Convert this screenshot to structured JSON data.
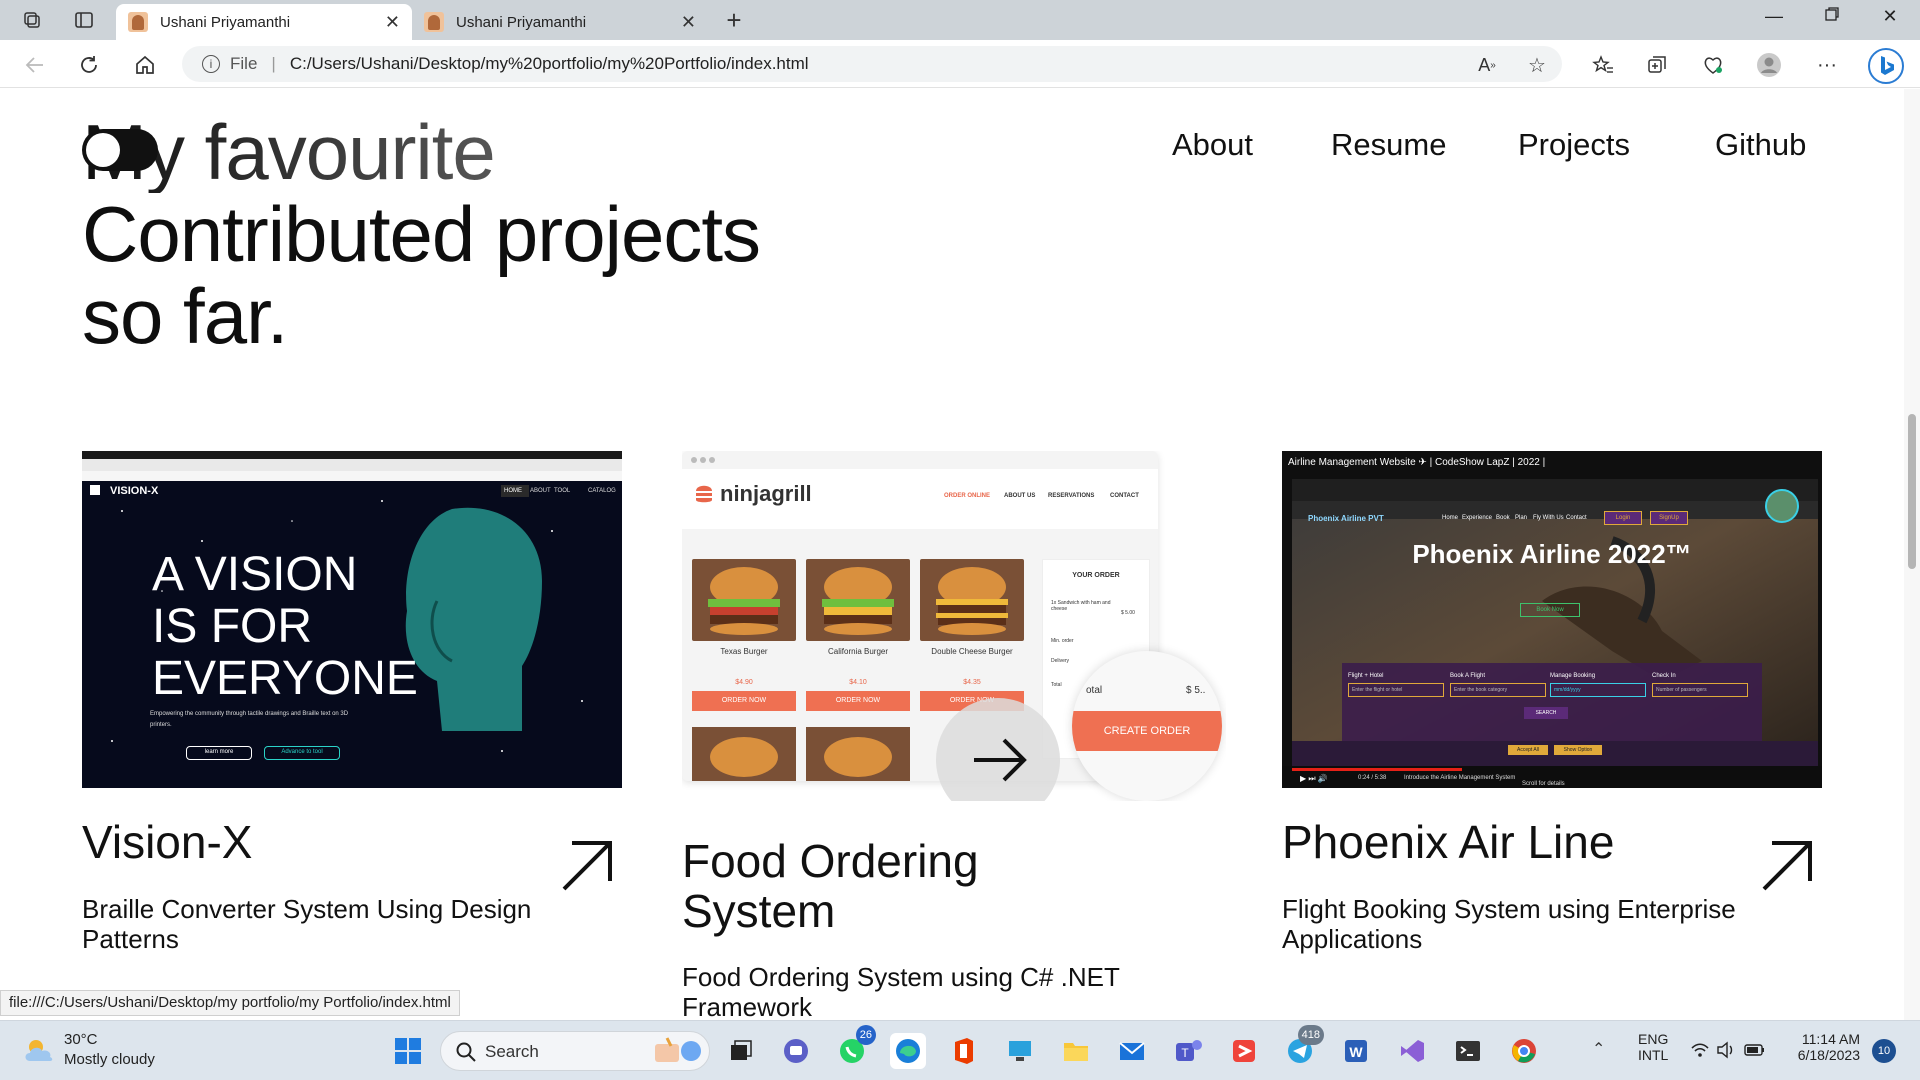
{
  "browser": {
    "tabs": [
      {
        "title": "Ushani Priyamanthi",
        "active": true
      },
      {
        "title": "Ushani Priyamanthi",
        "active": false
      }
    ],
    "address_prefix": "File",
    "address": "C:/Users/Ushani/Desktop/my%20portfolio/my%20Portfolio/index.html",
    "status_url": "file:///C:/Users/Ushani/Desktop/my portfolio/my Portfolio/index.html"
  },
  "page": {
    "hero": {
      "line1": "My favourite",
      "line2": "Contributed projects",
      "line3": "so far."
    },
    "nav": [
      "About",
      "Resume",
      "Projects",
      "Github"
    ],
    "projects": [
      {
        "title": "Vision-X",
        "description": "Braille Converter System Using Design Patterns",
        "thumb": {
          "heading": "A VISION IS FOR EVERYONE",
          "line_a": "A VISION",
          "line_b": "IS FOR",
          "line_c": "EVERYONE",
          "brand": "VISION-X",
          "menu": [
            "HOME",
            "ABOUT",
            "TOOL",
            "CATALOG"
          ],
          "tagline_1": "Empowering the community through tactile drawings and Braille text on 3D",
          "tagline_2": "printers.",
          "btn1": "learn more",
          "btn2": "Advance to tool"
        }
      },
      {
        "title": "Food Ordering System",
        "title_l1": "Food Ordering",
        "title_l2": "System",
        "description": "Food Ordering System using C# .NET Framework",
        "desc_l1": "Food Ordering System using C# .NET",
        "desc_l2": "Framework",
        "thumb": {
          "brand": "ninjagrill",
          "menu": [
            "ORDER ONLINE",
            "ABOUT US",
            "RESERVATIONS",
            "CONTACT"
          ],
          "items": [
            {
              "name": "Texas Burger",
              "price": "$4.90"
            },
            {
              "name": "California Burger",
              "price": "$4.10"
            },
            {
              "name": "Double Cheese Burger",
              "price": "$4.35"
            }
          ],
          "order_btn": "ORDER NOW",
          "your_order": "YOUR ORDER",
          "order_line": "1x Sandwich with ham and cheese",
          "order_price": "$ 5.00",
          "min_order": "Min. order",
          "delivery": "Delivery",
          "total": "Total",
          "total_short": "otal",
          "total_amt": "$ 5..",
          "create_order": "CREATE ORDER"
        }
      },
      {
        "title": "Phoenix Air Line",
        "description": "Flight Booking System using Enterprise Applications",
        "desc_l1": "Flight Booking System using Enterprise",
        "desc_l2": "Applications",
        "thumb": {
          "video_title": "Airline Management Website ✈ | CodeShow LapZ | 2022 |",
          "brand": "Phoenix Airline PVT",
          "headline": "Phoenix Airline 2022™",
          "menu": [
            "Home",
            "Experience",
            "Book",
            "Plan",
            "Fly With Us",
            "Contact"
          ],
          "login": "Login",
          "signup": "SignUp",
          "book_now": "Book Now",
          "fields": [
            "Flight + Hotel",
            "Book A Flight",
            "Manage Booking",
            "Check In"
          ],
          "placeholders": [
            "Enter the flight or hotel",
            "Enter the book category",
            "mm/dd/yyyy",
            "Number of passengers"
          ],
          "search": "SEARCH",
          "accept": "Accept All",
          "show_option": "Show Option",
          "time": "0:24 / 5:38",
          "chapter": "Introduce the Airline Management System",
          "scroll": "Scroll for details"
        }
      }
    ]
  },
  "taskbar": {
    "weather_temp": "30°C",
    "weather_desc": "Mostly cloudy",
    "search": "Search",
    "lang_1": "ENG",
    "lang_2": "INTL",
    "time": "11:14 AM",
    "date": "6/18/2023",
    "notifications": "10",
    "whatsapp_badge": "26",
    "telegram_badge": "418"
  }
}
